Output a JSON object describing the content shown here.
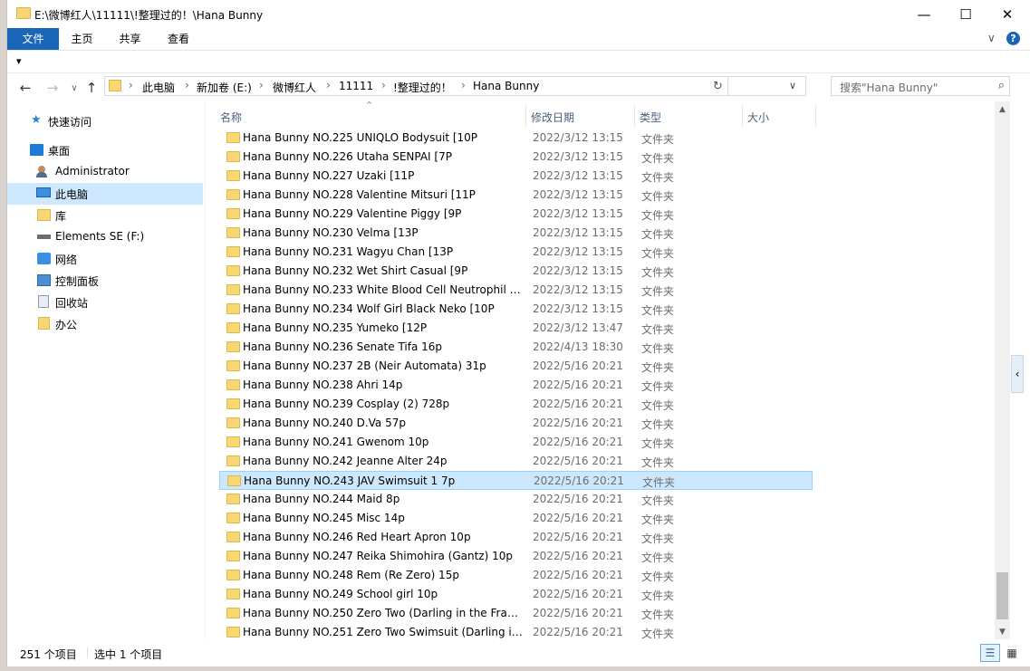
{
  "window": {
    "title": "E:\\微博红人\\11111\\!整理过的！\\Hana Bunny",
    "minimize": "—",
    "maximize": "☐",
    "close": "✕"
  },
  "ribbon": {
    "tabs": [
      {
        "label": "文件",
        "active": true
      },
      {
        "label": "主页",
        "active": false
      },
      {
        "label": "共享",
        "active": false
      },
      {
        "label": "查看",
        "active": false
      }
    ],
    "expand_icon": "∨",
    "help_icon": "?",
    "qat_icon": "▾"
  },
  "nav": {
    "back": "←",
    "forward": "→",
    "dropdown": "∨",
    "up": "↑",
    "breadcrumb": [
      "此电脑",
      "新加卷 (E:)",
      "微博红人",
      "11111",
      "!整理过的！",
      "Hana Bunny"
    ],
    "addr_dropdown": "∨",
    "refresh": "↻",
    "search_placeholder": "搜索\"Hana Bunny\"",
    "search_icon": "⌕"
  },
  "sidebar": {
    "items": [
      {
        "label": "快速访问",
        "icon": "star-icon"
      },
      {
        "label": "桌面",
        "icon": "desktop-icon"
      },
      {
        "label": "Administrator",
        "icon": "user-icon"
      },
      {
        "label": "此电脑",
        "icon": "computer-icon",
        "selected": true
      },
      {
        "label": "库",
        "icon": "library-icon"
      },
      {
        "label": "Elements SE (F:)",
        "icon": "drive-icon"
      },
      {
        "label": "网络",
        "icon": "network-icon"
      },
      {
        "label": "控制面板",
        "icon": "control-panel-icon"
      },
      {
        "label": "回收站",
        "icon": "recycle-bin-icon"
      },
      {
        "label": "办公",
        "icon": "folder-icon"
      }
    ]
  },
  "columns": {
    "name": "名称",
    "date": "修改日期",
    "type": "类型",
    "size": "大小",
    "sort_indicator": "⌃"
  },
  "files": [
    {
      "name": "Hana Bunny NO.225 UNIQLO Bodysuit [10P",
      "date": "2022/3/12 13:15",
      "type": "文件夹"
    },
    {
      "name": "Hana Bunny NO.226 Utaha SENPAI [7P",
      "date": "2022/3/12 13:15",
      "type": "文件夹"
    },
    {
      "name": "Hana Bunny NO.227 Uzaki [11P",
      "date": "2022/3/12 13:15",
      "type": "文件夹"
    },
    {
      "name": "Hana Bunny NO.228 Valentine Mitsuri [11P",
      "date": "2022/3/12 13:15",
      "type": "文件夹"
    },
    {
      "name": "Hana Bunny NO.229 Valentine Piggy [9P",
      "date": "2022/3/12 13:15",
      "type": "文件夹"
    },
    {
      "name": "Hana Bunny NO.230 Velma [13P",
      "date": "2022/3/12 13:15",
      "type": "文件夹"
    },
    {
      "name": "Hana Bunny NO.231 Wagyu Chan [13P",
      "date": "2022/3/12 13:15",
      "type": "文件夹"
    },
    {
      "name": "Hana Bunny NO.232 Wet Shirt Casual [9P",
      "date": "2022/3/12 13:15",
      "type": "文件夹"
    },
    {
      "name": "Hana Bunny NO.233 White Blood Cell Neutrophil (...",
      "date": "2022/3/12 13:15",
      "type": "文件夹"
    },
    {
      "name": "Hana Bunny NO.234 Wolf Girl Black Neko [10P",
      "date": "2022/3/12 13:15",
      "type": "文件夹"
    },
    {
      "name": "Hana Bunny NO.235 Yumeko [12P",
      "date": "2022/3/12 13:47",
      "type": "文件夹"
    },
    {
      "name": "Hana Bunny NO.236 Senate Tifa 16p",
      "date": "2022/4/13 18:30",
      "type": "文件夹"
    },
    {
      "name": "Hana Bunny NO.237 2B (Neir Automata) 31p",
      "date": "2022/5/16 20:21",
      "type": "文件夹"
    },
    {
      "name": "Hana Bunny NO.238 Ahri 14p",
      "date": "2022/5/16 20:21",
      "type": "文件夹"
    },
    {
      "name": "Hana Bunny NO.239 Cosplay (2) 728p",
      "date": "2022/5/16 20:21",
      "type": "文件夹"
    },
    {
      "name": "Hana Bunny NO.240 D.Va 57p",
      "date": "2022/5/16 20:21",
      "type": "文件夹"
    },
    {
      "name": "Hana Bunny NO.241 Gwenom 10p",
      "date": "2022/5/16 20:21",
      "type": "文件夹"
    },
    {
      "name": "Hana Bunny NO.242 Jeanne Alter 24p",
      "date": "2022/5/16 20:21",
      "type": "文件夹"
    },
    {
      "name": "Hana Bunny NO.243 JAV Swimsuit 1 7p",
      "date": "2022/5/16 20:21",
      "type": "文件夹",
      "selected": true
    },
    {
      "name": "Hana Bunny NO.244 Maid 8p",
      "date": "2022/5/16 20:21",
      "type": "文件夹"
    },
    {
      "name": "Hana Bunny NO.245 Misc 14p",
      "date": "2022/5/16 20:21",
      "type": "文件夹"
    },
    {
      "name": "Hana Bunny NO.246 Red Heart Apron 10p",
      "date": "2022/5/16 20:21",
      "type": "文件夹"
    },
    {
      "name": "Hana Bunny NO.247 Reika Shimohira (Gantz) 10p",
      "date": "2022/5/16 20:21",
      "type": "文件夹"
    },
    {
      "name": "Hana Bunny NO.248 Rem (Re Zero) 15p",
      "date": "2022/5/16 20:21",
      "type": "文件夹"
    },
    {
      "name": "Hana Bunny NO.249 School girl 10p",
      "date": "2022/5/16 20:21",
      "type": "文件夹"
    },
    {
      "name": "Hana Bunny NO.250 Zero Two (Darling in the Franx...",
      "date": "2022/5/16 20:21",
      "type": "文件夹"
    },
    {
      "name": "Hana Bunny NO.251 Zero Two Swimsuit (Darling in ...",
      "date": "2022/5/16 20:21",
      "type": "文件夹"
    }
  ],
  "status": {
    "count": "251 个项目",
    "selected": "选中 1 个项目"
  },
  "side_tab": "‹",
  "scroll_up": "▲",
  "scroll_down": "▼",
  "view_details_icon": "☰",
  "view_tiles_icon": "▦",
  "colors": {
    "accent": "#1a66b8",
    "selection": "#cce8ff",
    "selection_border": "#99d1ff",
    "folder": "#f8d775"
  }
}
